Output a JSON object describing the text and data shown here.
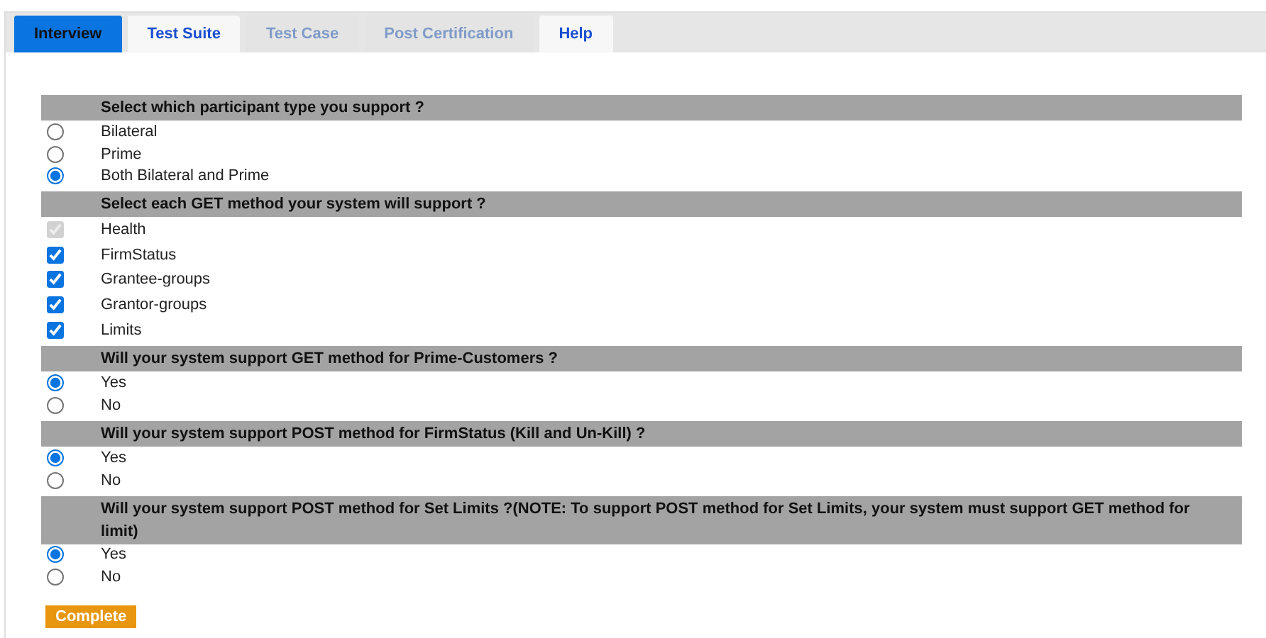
{
  "tabs": [
    {
      "label": "Interview",
      "selected": true,
      "disabled": false
    },
    {
      "label": "Test Suite",
      "selected": false,
      "disabled": false
    },
    {
      "label": "Test Case",
      "selected": false,
      "disabled": true
    },
    {
      "label": "Post Certification",
      "selected": false,
      "disabled": true
    },
    {
      "label": "Help",
      "selected": false,
      "disabled": false
    }
  ],
  "questions": [
    {
      "title": "Select which participant type you support ?",
      "options": [
        {
          "kind": "radio",
          "label": "Bilateral",
          "selected": false,
          "disabled": false
        },
        {
          "kind": "radio",
          "label": "Prime",
          "selected": false,
          "disabled": false
        },
        {
          "kind": "radio",
          "label": "Both Bilateral and Prime",
          "selected": true,
          "disabled": false
        }
      ]
    },
    {
      "title": "Select each GET method your system will support ?",
      "options": [
        {
          "kind": "checkbox",
          "label": "Health",
          "checked": true,
          "disabled": true
        },
        {
          "kind": "checkbox",
          "label": "FirmStatus",
          "checked": true,
          "disabled": false
        },
        {
          "kind": "checkbox",
          "label": "Grantee-groups",
          "checked": true,
          "disabled": false
        },
        {
          "kind": "checkbox",
          "label": "Grantor-groups",
          "checked": true,
          "disabled": false
        },
        {
          "kind": "checkbox",
          "label": "Limits",
          "checked": true,
          "disabled": false
        }
      ]
    },
    {
      "title": "Will your system support GET method for Prime-Customers ?",
      "options": [
        {
          "kind": "radio",
          "label": "Yes",
          "selected": true,
          "disabled": false
        },
        {
          "kind": "radio",
          "label": "No",
          "selected": false,
          "disabled": false
        }
      ]
    },
    {
      "title": "Will your system support POST method for FirmStatus (Kill and Un-Kill) ?",
      "options": [
        {
          "kind": "radio",
          "label": "Yes",
          "selected": true,
          "disabled": false
        },
        {
          "kind": "radio",
          "label": "No",
          "selected": false,
          "disabled": false
        }
      ]
    },
    {
      "title": "Will your system support POST method for Set Limits ?(NOTE: To support POST method for Set Limits, your system must support GET method for limit)",
      "options": [
        {
          "kind": "radio",
          "label": "Yes",
          "selected": true,
          "disabled": false
        },
        {
          "kind": "radio",
          "label": "No",
          "selected": false,
          "disabled": false
        }
      ]
    }
  ],
  "complete_button": "Complete"
}
